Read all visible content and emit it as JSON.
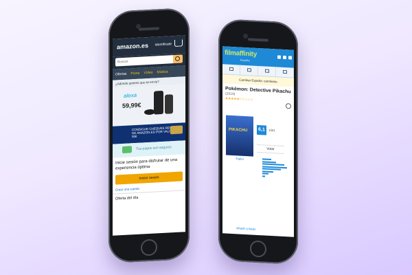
{
  "amazon": {
    "logo": "amazon.es",
    "login": "Identifícate",
    "search_placeholder": "Buscar",
    "nav": [
      "Ofertas",
      "Prime",
      "Vídeo",
      "Música"
    ],
    "location": "¿Adónde quieres que se envíe?",
    "alexa": "alexa",
    "price": "59,99€",
    "promo": "CONSIGUE CHEQUES REGALO DE AMAZON.ES POR VALOR DE 50€",
    "secure_payment": "Tus pagos son seguros",
    "signin_text": "Inicie sesión para disfrutar de una experiencia óptima",
    "signin_button": "Iniciar sesión",
    "create_account": "Crear una cuenta",
    "deal": "Oferta del día"
  },
  "filmaffinity": {
    "logo": "filmaffinity",
    "logo_sub": "España",
    "notice": "Cambiar España: cambiarte",
    "title": "Pokémon: Detective Pikachu",
    "year": "(2019)",
    "stars": "★★★★★☆☆☆☆☆",
    "poster_title": "PIKACHU",
    "trailer": "Tráiler",
    "score": "6,1",
    "votes": "1561",
    "vote_label": "Votar",
    "histogram": [
      0.35,
      0.55,
      0.9,
      1.0,
      0.75,
      0.45,
      0.25,
      0.12
    ],
    "more": "Añadir a listas"
  },
  "colors": {
    "amazon_dark": "#232f3e",
    "amazon_orange": "#f0a500",
    "filmaffinity_blue": "#1e89d6",
    "background_purple": "#d9c9ff"
  }
}
